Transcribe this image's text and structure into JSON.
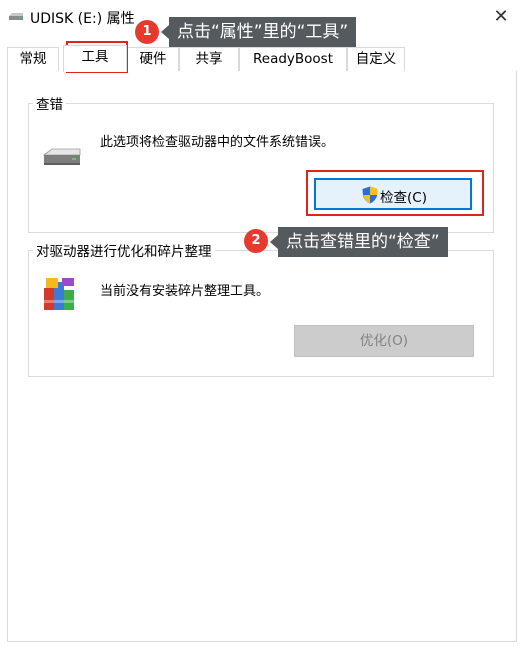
{
  "window": {
    "title": "UDISK (E:) 属性",
    "close_symbol": "✕"
  },
  "tabs": [
    {
      "label": "常规"
    },
    {
      "label": "工具"
    },
    {
      "label": "硬件"
    },
    {
      "label": "共享"
    },
    {
      "label": "ReadyBoost"
    },
    {
      "label": "自定义"
    }
  ],
  "active_tab": "工具",
  "error_checking": {
    "title": "查错",
    "description": "此选项将检查驱动器中的文件系统错误。",
    "button_label": "检查(C)"
  },
  "optimize": {
    "title": "对驱动器进行优化和碎片整理",
    "description": "当前没有安装碎片整理工具。",
    "button_label": "优化(O)"
  },
  "annotations": [
    {
      "number": "1",
      "text": "点击“属性”里的“工具”"
    },
    {
      "number": "2",
      "text": "点击查错里的“检查”"
    }
  ],
  "colors": {
    "highlight_red": "#e2231a",
    "badge_red": "#e8392e",
    "callout_bg": "#555a5f",
    "check_button_border": "#0078d7"
  }
}
